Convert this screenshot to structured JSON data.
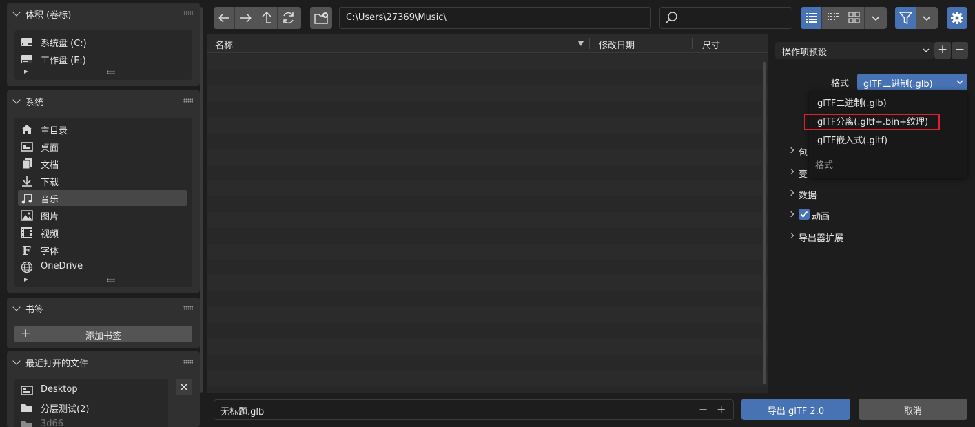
{
  "sidebar": {
    "volumes": {
      "title": "体积 (卷标)",
      "items": [
        {
          "label": "系统盘 (C:)",
          "icon": "drive-icon"
        },
        {
          "label": "工作盘 (E:)",
          "icon": "drive-icon"
        }
      ]
    },
    "system": {
      "title": "系统",
      "items": [
        {
          "label": "主目录",
          "icon": "home-icon"
        },
        {
          "label": "桌面",
          "icon": "desktop-icon"
        },
        {
          "label": "文档",
          "icon": "documents-icon"
        },
        {
          "label": "下载",
          "icon": "download-icon"
        },
        {
          "label": "音乐",
          "icon": "music-icon",
          "active": true
        },
        {
          "label": "图片",
          "icon": "picture-icon"
        },
        {
          "label": "视频",
          "icon": "video-icon"
        },
        {
          "label": "字体",
          "icon": "font-icon"
        },
        {
          "label": "OneDrive",
          "icon": "globe-icon"
        }
      ]
    },
    "bookmarks": {
      "title": "书签",
      "add_label": "添加书签"
    },
    "recent": {
      "title": "最近打开的文件",
      "items": [
        {
          "label": "Desktop",
          "icon": "desktop-icon"
        },
        {
          "label": "分层测试(2)",
          "icon": "folder-icon"
        },
        {
          "label": "3d66",
          "icon": "folder-icon"
        }
      ]
    }
  },
  "toolbar": {
    "path": "C:\\Users\\27369\\Music\\",
    "search_placeholder": ""
  },
  "filelist": {
    "columns": [
      "名称",
      "修改日期",
      "尺寸"
    ]
  },
  "bottom": {
    "filename": "无标题.glb",
    "minus": "−",
    "plus": "+",
    "export_label": "导出 glTF 2.0",
    "cancel_label": "取消"
  },
  "right": {
    "preset_label": "操作项预设",
    "format_label": "格式",
    "format_value": "glTF二进制(.glb)",
    "sections": [
      {
        "label": "包"
      },
      {
        "label": "变"
      },
      {
        "label": "数据"
      },
      {
        "label": "动画",
        "checked": true
      },
      {
        "label": "导出器扩展"
      }
    ],
    "dropdown": {
      "options": [
        "glTF二进制(.glb)",
        "glTF分离(.gltf+.bin+纹理)",
        "glTF嵌入式(.gltf)"
      ],
      "footer": "格式"
    }
  },
  "colors": {
    "accent": "#4772b3",
    "highlight_box": "#e02030",
    "panel": "#303030",
    "background": "#1d1d1d"
  }
}
